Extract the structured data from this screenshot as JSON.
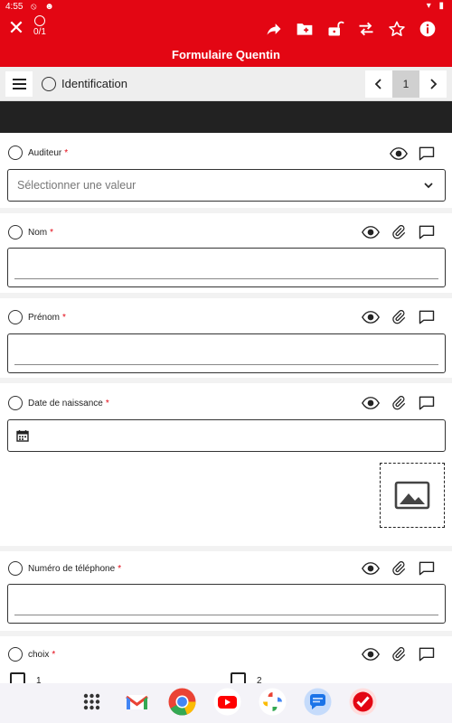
{
  "status_bar": {
    "time": "4:55",
    "left_icons": "⦸ ☻",
    "right_icons": "▾ ▮"
  },
  "header": {
    "close_icon": "close-icon",
    "progress": "0/1",
    "title": "Formulaire Quentin",
    "toolbar_icons": [
      "share-icon",
      "add-folder-icon",
      "unlock-icon",
      "sync-icon",
      "star-icon",
      "info-icon"
    ]
  },
  "section": {
    "name": "Identification",
    "page": "1",
    "prev_icon": "‹",
    "next_icon": "›"
  },
  "fields": [
    {
      "label": "Auditeur",
      "required": "*",
      "type": "select",
      "placeholder": "Sélectionner une valeur"
    },
    {
      "label": "Nom",
      "required": "*",
      "type": "text",
      "value": ""
    },
    {
      "label": "Prénom",
      "required": "*",
      "type": "text",
      "value": ""
    },
    {
      "label": "Date de naissance",
      "required": "*",
      "type": "date",
      "value": ""
    },
    {
      "label": "Numéro de téléphone",
      "required": "*",
      "type": "text",
      "value": ""
    },
    {
      "label": "choix",
      "required": "*",
      "type": "checkbox",
      "options": [
        "1",
        "2"
      ]
    }
  ],
  "dock": {
    "apps": [
      "apps-grid-icon",
      "gmail-icon",
      "chrome-icon",
      "youtube-icon",
      "photos-icon",
      "messages-icon",
      "checklist-app-icon"
    ]
  },
  "colors": {
    "brand_red": "#e30613",
    "dark_band": "#222222",
    "required_star": "#e30613"
  }
}
